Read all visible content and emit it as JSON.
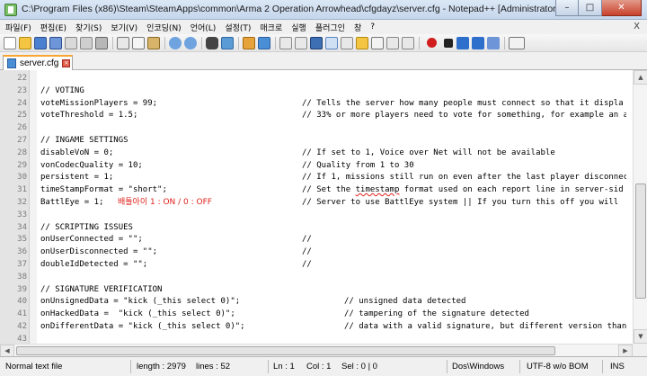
{
  "window": {
    "title": "C:\\Program Files (x86)\\Steam\\SteamApps\\common\\Arma 2 Operation Arrowhead\\cfgdayz\\server.cfg - Notepad++ [Administrator]",
    "minimize": "–",
    "maximize": "□",
    "close": "✕"
  },
  "menu": [
    "파일(F)",
    "편집(E)",
    "찾기(S)",
    "보기(V)",
    "인코딩(N)",
    "언어(L)",
    "설정(T)",
    "매크로",
    "실행",
    "플러그인",
    "창",
    "?"
  ],
  "menu_close": "X",
  "toolbar": {
    "icons": [
      "new-file",
      "open-file",
      "save",
      "save-all",
      "close",
      "close-all",
      "print",
      "cut",
      "copy",
      "paste",
      "undo",
      "redo",
      "find",
      "replace",
      "zoom-in",
      "zoom-out",
      "sync-vertical",
      "sync-horizontal",
      "word-wrap",
      "show-all-chars",
      "indent-guide",
      "user-language",
      "document-map",
      "function-list",
      "folder-as-workspace",
      "record-macro",
      "stop-record",
      "play-macro",
      "run-macro-multiple",
      "save-macro",
      "spell-check"
    ]
  },
  "tab": {
    "label": "server.cfg"
  },
  "editor": {
    "lines": [
      {
        "no": "22",
        "c1": "",
        "c2": "",
        "c3": ""
      },
      {
        "no": "23",
        "c1": "// VOTING",
        "c2": "",
        "c3": ""
      },
      {
        "no": "24",
        "c1": "voteMissionPlayers = 99;",
        "c2": "",
        "c3": "// Tells the server how many people must connect so that it displa"
      },
      {
        "no": "25",
        "c1": "voteThreshold = 1.5;",
        "c2": "",
        "c3": "// 33% or more players need to vote for something, for example an a"
      },
      {
        "no": "26",
        "c1": "",
        "c2": "",
        "c3": ""
      },
      {
        "no": "27",
        "c1": "// INGAME SETTINGS",
        "c2": "",
        "c3": ""
      },
      {
        "no": "28",
        "c1": "disableVoN = 0;",
        "c2": "",
        "c3": "// If set to 1, Voice over Net will not be available"
      },
      {
        "no": "29",
        "c1": "vonCodecQuality = 10;",
        "c2": "",
        "c3": "// Quality from 1 to 30"
      },
      {
        "no": "30",
        "c1": "persistent = 1;",
        "c2": "",
        "c3": "// If 1, missions still run on even after the last player disconnec"
      },
      {
        "no": "31",
        "c1": "timeStampFormat = \"short\";",
        "c2": "",
        "c3_pre": "// Set the ",
        "c3_sq": "timestamp",
        "c3_post": " format used on each report line in server-sid"
      },
      {
        "no": "32",
        "c1": "BattlEye = 1;",
        "kr": "배틀아이 1 : ON / 0 : OFF",
        "c3": "// Server to use BattlEye system || If you turn this off you will "
      },
      {
        "no": "33",
        "c1": "",
        "c2": "",
        "c3": ""
      },
      {
        "no": "34",
        "c1": "// SCRIPTING ISSUES",
        "c2": "",
        "c3": ""
      },
      {
        "no": "35",
        "c1": "onUserConnected = \"\";",
        "c2": "",
        "c3": "//"
      },
      {
        "no": "36",
        "c1": "onUserDisconnected = \"\";",
        "c2": "",
        "c3": "//"
      },
      {
        "no": "37",
        "c1": "doubleIdDetected = \"\";",
        "c2": "",
        "c3": "//"
      },
      {
        "no": "38",
        "c1": "",
        "c2": "",
        "c3": ""
      },
      {
        "no": "39",
        "c1": "// SIGNATURE VERIFICATION",
        "c2": "",
        "c3": ""
      },
      {
        "no": "40",
        "c1": "onUnsignedData = \"kick (_this select 0)\";",
        "c4": "// unsigned data detected"
      },
      {
        "no": "41",
        "c1": "onHackedData =  \"kick (_this select 0)\";",
        "c4": "// tampering of the signature detected"
      },
      {
        "no": "42",
        "c1": "onDifferentData = \"kick (_this select 0)\";",
        "c4": "// data with a valid signature, but different version than"
      },
      {
        "no": "43",
        "c1": "",
        "c2": "",
        "c3": ""
      }
    ]
  },
  "status": {
    "type": "Normal text file",
    "length": "length : 2979",
    "lines": "lines : 52",
    "ln": "Ln : 1",
    "col": "Col : 1",
    "sel": "Sel : 0 | 0",
    "eol": "Dos\\Windows",
    "encoding": "UTF-8 w/o BOM",
    "mode": "INS"
  },
  "colors": {
    "korean_note": "#e0201b",
    "tab_accent": "#f9a531"
  }
}
